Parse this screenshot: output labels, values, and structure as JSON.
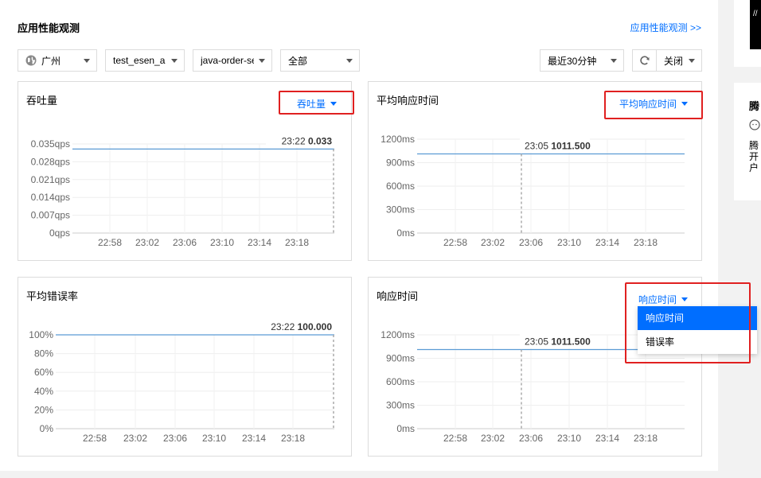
{
  "page": {
    "title": "应用性能观测",
    "link": "应用性能观测 >>"
  },
  "filters": {
    "region": "广州",
    "instance": "test_esen_a",
    "service": "java-order-se",
    "scope": "全部",
    "time_range": "最近30分钟",
    "refresh_mode": "关闭"
  },
  "charts": [
    {
      "title": "吞吐量",
      "metric": "吞吐量",
      "chart_data": {
        "type": "line",
        "x": [
          "22:58",
          "23:02",
          "23:06",
          "23:10",
          "23:14",
          "23:18"
        ],
        "yticks": [
          "0qps",
          "0.007qps",
          "0.014qps",
          "0.021qps",
          "0.028qps",
          "0.035qps"
        ],
        "ylim": [
          0,
          0.035
        ],
        "series": [
          {
            "values": [
              0.033,
              0.033,
              0.033,
              0.033,
              0.033,
              0.033,
              0.033
            ]
          }
        ],
        "tooltip": {
          "time": "23:22",
          "value": "0.033"
        }
      }
    },
    {
      "title": "平均响应时间",
      "metric": "平均响应时间",
      "chart_data": {
        "type": "line",
        "x": [
          "22:58",
          "23:02",
          "23:06",
          "23:10",
          "23:14",
          "23:18"
        ],
        "yticks": [
          "0ms",
          "300ms",
          "600ms",
          "900ms",
          "1200ms"
        ],
        "ylim": [
          0,
          1200
        ],
        "series": [
          {
            "values": [
              1011.5,
              1011.5,
              1011.5,
              1011.5,
              1011.5,
              1011.5,
              1011.5
            ]
          }
        ],
        "tooltip": {
          "time": "23:05",
          "value": "1011.500"
        }
      }
    },
    {
      "title": "平均错误率",
      "metric": "",
      "chart_data": {
        "type": "line",
        "x": [
          "22:58",
          "23:02",
          "23:06",
          "23:10",
          "23:14",
          "23:18"
        ],
        "yticks": [
          "0%",
          "20%",
          "40%",
          "60%",
          "80%",
          "100%"
        ],
        "ylim": [
          0,
          100
        ],
        "series": [
          {
            "values": [
              100,
              100,
              100,
              100,
              100,
              100,
              100
            ]
          }
        ],
        "tooltip": {
          "time": "23:22",
          "value": "100.000"
        }
      }
    },
    {
      "title": "响应时间",
      "metric": "响应时间",
      "chart_data": {
        "type": "line",
        "x": [
          "22:58",
          "23:02",
          "23:06",
          "23:10",
          "23:14",
          "23:18"
        ],
        "yticks": [
          "0ms",
          "300ms",
          "600ms",
          "900ms",
          "1200ms"
        ],
        "ylim": [
          0,
          1200
        ],
        "series": [
          {
            "values": [
              1011.5,
              1011.5,
              1011.5,
              1011.5,
              1011.5,
              1011.5,
              1011.5
            ]
          }
        ],
        "tooltip": {
          "time": "23:05",
          "value": "1011.500"
        }
      }
    }
  ],
  "dropdown": {
    "options": [
      "响应时间",
      "错误率"
    ],
    "selected": "响应时间"
  },
  "right_panel": {
    "title": "腾",
    "lines": [
      "腾",
      "开",
      "户"
    ]
  },
  "colors": {
    "accent": "#006eff",
    "highlight": "#e02020",
    "series": "#5b9bd5"
  }
}
